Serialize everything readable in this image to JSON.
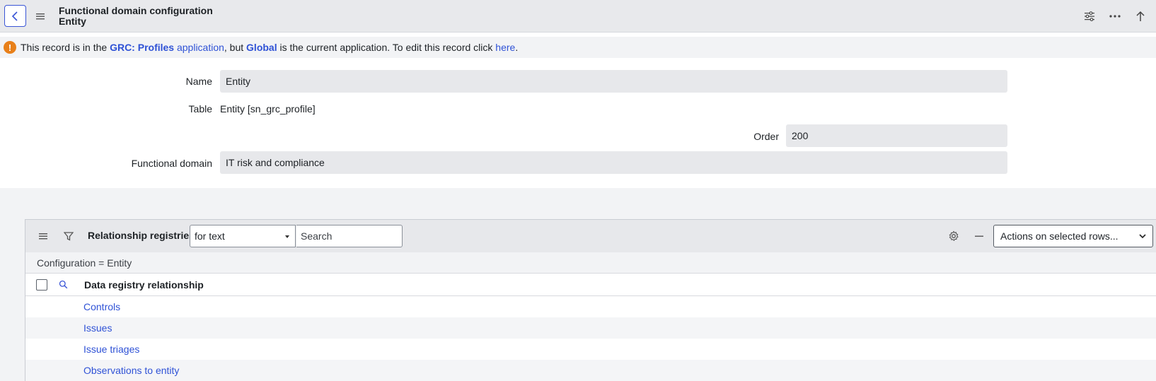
{
  "header": {
    "title": "Functional domain configuration",
    "subtitle": "Entity",
    "icons": [
      "back-icon",
      "menu-icon",
      "settings-sliders-icon",
      "more-icon",
      "up-arrow-icon"
    ]
  },
  "notice": {
    "prefix": "This record is in the ",
    "app_name": "GRC: Profiles",
    "app_link": "application",
    "middle": ", but ",
    "current_app": "Global",
    "suffix": " is the current application. To edit this record click ",
    "here_link": "here",
    "end": ".",
    "icon": "warning-icon",
    "icon_glyph": "!"
  },
  "form": {
    "name_label": "Name",
    "name_value": "Entity",
    "table_label": "Table",
    "table_value": "Entity [sn_grc_profile]",
    "order_label": "Order",
    "order_value": "200",
    "domain_label": "Functional domain",
    "domain_value": "IT risk and compliance"
  },
  "related_list": {
    "title": "Relationship registries",
    "filter_select": "for text",
    "search_placeholder": "Search",
    "actions_select": "Actions on selected rows...",
    "breadcrumb": "Configuration = Entity",
    "column_header": "Data registry relationship",
    "rows": [
      "Controls",
      "Issues",
      "Issue triages",
      "Observations to entity"
    ]
  },
  "colors": {
    "accent": "#2f52d6",
    "warning": "#e8801a",
    "header_bg": "#e8e9ec"
  }
}
